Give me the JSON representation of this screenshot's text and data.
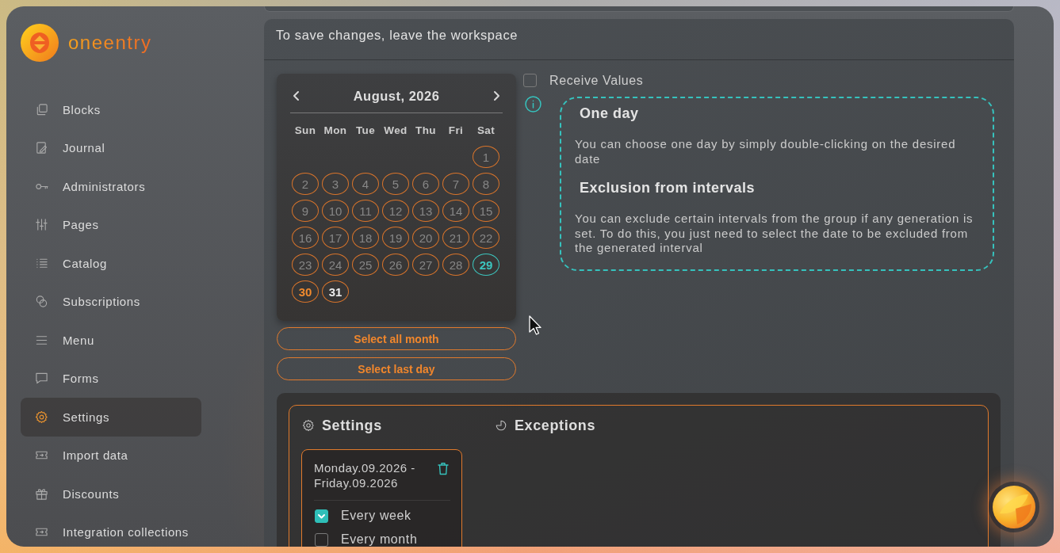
{
  "logo": {
    "text": "oneentry"
  },
  "sidebar": {
    "items": [
      {
        "label": "Blocks",
        "selected": false
      },
      {
        "label": "Journal",
        "selected": false
      },
      {
        "label": "Administrators",
        "selected": false
      },
      {
        "label": "Pages",
        "selected": false
      },
      {
        "label": "Catalog",
        "selected": false
      },
      {
        "label": "Subscriptions",
        "selected": false
      },
      {
        "label": "Menu",
        "selected": false
      },
      {
        "label": "Forms",
        "selected": false
      },
      {
        "label": "Settings",
        "selected": true
      },
      {
        "label": "Import data",
        "selected": false
      },
      {
        "label": "Discounts",
        "selected": false
      },
      {
        "label": "Integration collections",
        "selected": false
      }
    ]
  },
  "notice": "To save changes, leave the workspace",
  "calendar": {
    "month": "August, 2026",
    "weekdays": [
      "Sun",
      "Mon",
      "Tue",
      "Wed",
      "Thu",
      "Fri",
      "Sat"
    ],
    "weeks": [
      [
        {
          "day": "1",
          "kind": "past"
        }
      ],
      [
        {
          "day": "2",
          "kind": "past"
        },
        {
          "day": "3",
          "kind": "past"
        },
        {
          "day": "4",
          "kind": "past"
        },
        {
          "day": "5",
          "kind": "past"
        },
        {
          "day": "6",
          "kind": "past"
        },
        {
          "day": "7",
          "kind": "past"
        },
        {
          "day": "8",
          "kind": "past"
        }
      ],
      [
        {
          "day": "9",
          "kind": "past"
        },
        {
          "day": "10",
          "kind": "past"
        },
        {
          "day": "11",
          "kind": "past"
        },
        {
          "day": "12",
          "kind": "past"
        },
        {
          "day": "13",
          "kind": "past"
        },
        {
          "day": "14",
          "kind": "past"
        },
        {
          "day": "15",
          "kind": "past"
        }
      ],
      [
        {
          "day": "16",
          "kind": "past"
        },
        {
          "day": "17",
          "kind": "past"
        },
        {
          "day": "18",
          "kind": "past"
        },
        {
          "day": "19",
          "kind": "past"
        },
        {
          "day": "20",
          "kind": "past"
        },
        {
          "day": "21",
          "kind": "past"
        },
        {
          "day": "22",
          "kind": "past"
        }
      ],
      [
        {
          "day": "23",
          "kind": "past"
        },
        {
          "day": "24",
          "kind": "past"
        },
        {
          "day": "25",
          "kind": "past"
        },
        {
          "day": "26",
          "kind": "past"
        },
        {
          "day": "27",
          "kind": "past"
        },
        {
          "day": "28",
          "kind": "past"
        },
        {
          "day": "29",
          "kind": "today"
        }
      ],
      [
        {
          "day": "30",
          "kind": "weekend"
        },
        {
          "day": "31",
          "kind": "upcoming"
        }
      ]
    ]
  },
  "calendar_buttons": [
    {
      "label": "Select all month"
    },
    {
      "label": "Select last day"
    }
  ],
  "receive_values": {
    "label": "Receive Values",
    "checked": false
  },
  "help": [
    {
      "title": "One day",
      "text": "You can choose one day by simply double-clicking on the desired date"
    },
    {
      "title": "Exclusion from intervals",
      "text": "You can exclude certain intervals from the group if any generation is set. To do this, you just need to select the date to be excluded from the generated interval"
    }
  ],
  "schedule": {
    "columns": [
      {
        "title": "Settings",
        "intervals": [
          {
            "range": "Monday.09.2026 - Friday.09.2026",
            "options": [
              {
                "label": "Every week",
                "checked": true
              },
              {
                "label": "Every month",
                "checked": false
              }
            ]
          }
        ]
      },
      {
        "title": "Exceptions"
      }
    ]
  }
}
